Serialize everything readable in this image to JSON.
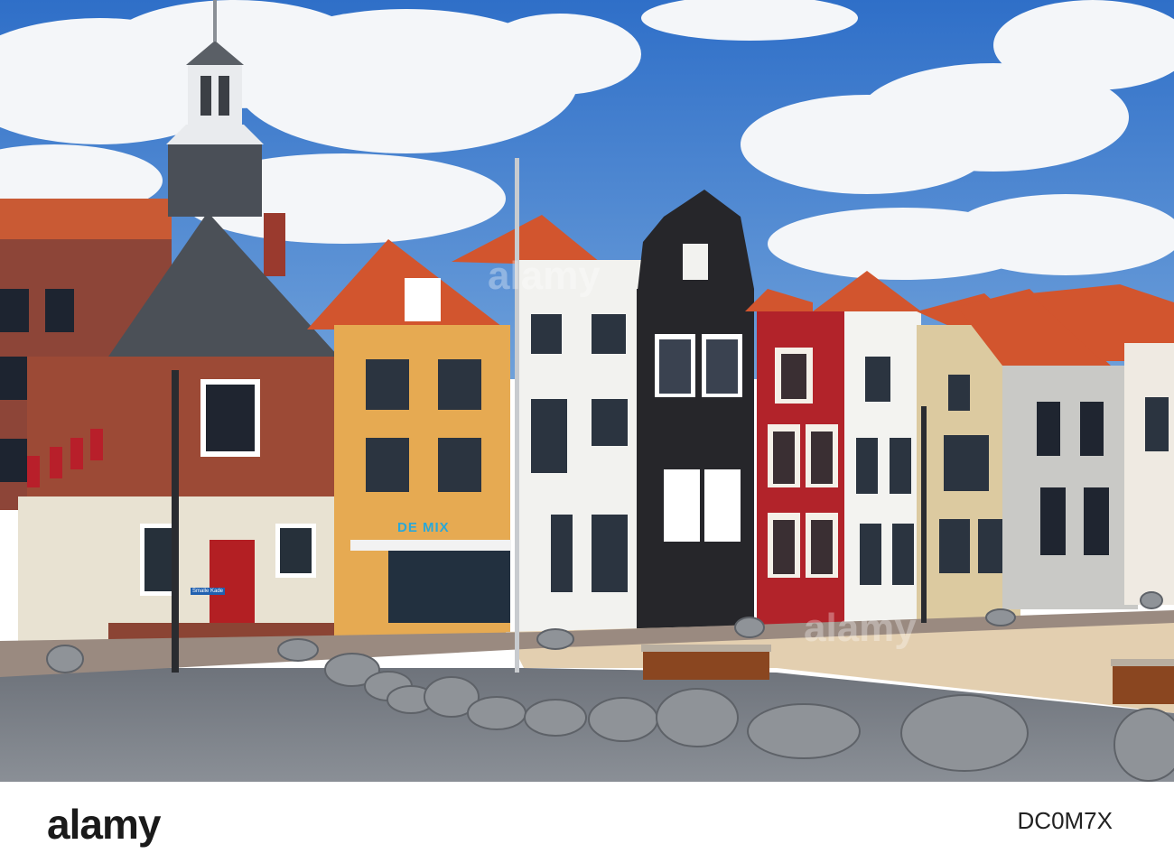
{
  "scene": {
    "description_label": "Dutch town square with historic gabled houses",
    "colors": {
      "sky": "#3f7fd0",
      "cloud": "#f4f6f9",
      "roof": "#d2552e",
      "brick": "#9c4a36",
      "slate": "#4b5057",
      "yellow_facade": "#e6aa52",
      "white_facade": "#f2f2ef",
      "black_facade": "#26262a",
      "red_facade": "#b2232a",
      "beige_facade": "#dccaa0",
      "grey_facade": "#c9c9c6",
      "pavement_dark": "#7c8088",
      "pavement_light": "#e3cfb0",
      "boulder": "#8f9398"
    }
  },
  "signs": {
    "cafe_name": "DE MIX",
    "street_sign": "Smalle Kade"
  },
  "watermark": {
    "text": "alamy"
  },
  "footer": {
    "logo": "alamy",
    "stock_code": "DC0M7X"
  }
}
